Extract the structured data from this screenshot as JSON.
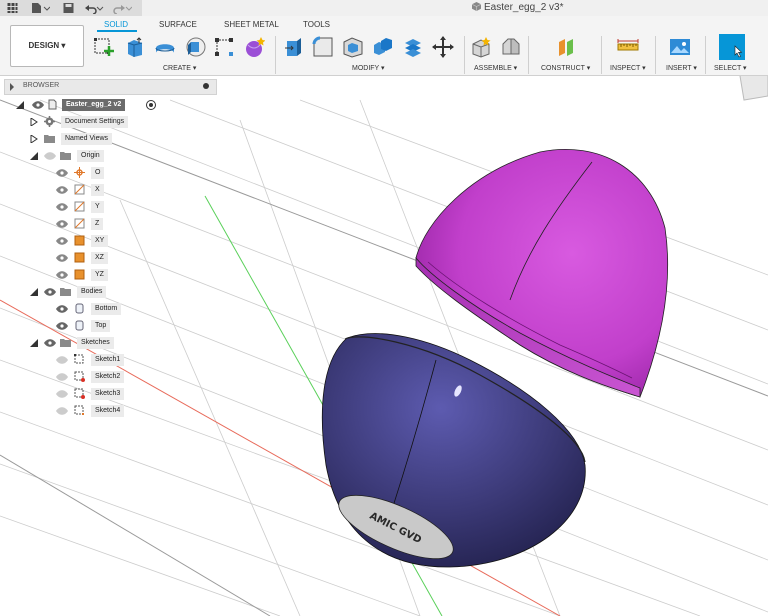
{
  "window": {
    "document_title": "Easter_egg_2 v3*"
  },
  "ribbon": {
    "workspace_button": "DESIGN ▾",
    "tabs": [
      "SOLID",
      "SURFACE",
      "SHEET METAL",
      "TOOLS"
    ],
    "active_tab": "SOLID",
    "groups": {
      "create": "CREATE ▾",
      "modify": "MODIFY ▾",
      "assemble": "ASSEMBLE ▾",
      "construct": "CONSTRUCT ▾",
      "inspect": "INSPECT ▾",
      "insert": "INSERT ▾",
      "select": "SELECT ▾"
    }
  },
  "browser": {
    "title": "BROWSER",
    "root": "Easter_egg_2 v2",
    "items": {
      "document_settings": "Document Settings",
      "named_views": "Named Views",
      "origin": "Origin",
      "origin_o": "O",
      "origin_x": "X",
      "origin_y": "Y",
      "origin_z": "Z",
      "origin_xy": "XY",
      "origin_xz": "XZ",
      "origin_yz": "YZ",
      "bodies": "Bodies",
      "body_bottom": "Bottom",
      "body_top": "Top",
      "sketches": "Sketches",
      "sketch1": "Sketch1",
      "sketch2": "Sketch2",
      "sketch3": "Sketch3",
      "sketch4": "Sketch4"
    }
  },
  "viewport": {
    "engraved_text": "AMIC GVD",
    "colors": {
      "top_body": "#c13fcb",
      "bottom_body": "#3c3a78",
      "x_axis": "#e86a5a",
      "z_axis": "#5ad05a",
      "accent": "#0696d7"
    }
  }
}
